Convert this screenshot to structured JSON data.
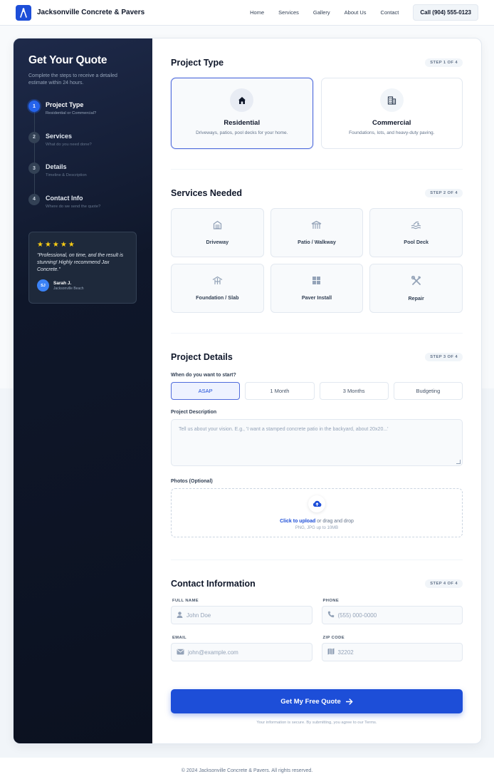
{
  "header": {
    "brand": "Jacksonville Concrete & Pavers",
    "nav": [
      "Home",
      "Services",
      "Gallery",
      "About Us",
      "Contact"
    ],
    "call": "Call (904) 555-0123"
  },
  "sidebar": {
    "title": "Get Your Quote",
    "subtitle": "Complete the steps to receive a detailed estimate within 24 hours.",
    "steps": [
      {
        "num": "1",
        "title": "Project Type",
        "desc": "Residential or Commercial?"
      },
      {
        "num": "2",
        "title": "Services",
        "desc": "What do you need done?"
      },
      {
        "num": "3",
        "title": "Details",
        "desc": "Timeline & Description"
      },
      {
        "num": "4",
        "title": "Contact Info",
        "desc": "Where do we send the quote?"
      }
    ],
    "review": {
      "rating": 5,
      "stars": "★★★★★",
      "quote": "\"Professional, on time, and the result is stunning! Highly recommend Jax Concrete.\"",
      "initials": "SJ",
      "name": "Sarah J.",
      "location": "Jacksonville Beach"
    }
  },
  "project_type": {
    "title": "Project Type",
    "badge": "STEP 1 OF 4",
    "options": [
      {
        "title": "Residential",
        "desc": "Driveways, patios, pool decks for your home.",
        "icon": "home-icon",
        "selected": true
      },
      {
        "title": "Commercial",
        "desc": "Foundations, lots, and heavy-duty paving.",
        "icon": "building-icon",
        "selected": false
      }
    ]
  },
  "services": {
    "title": "Services Needed",
    "badge": "STEP 2 OF 4",
    "items": [
      {
        "label": "Driveway",
        "icon": "garage-icon"
      },
      {
        "label": "Patio / Walkway",
        "icon": "deck-icon"
      },
      {
        "label": "Pool Deck",
        "icon": "pool-icon"
      },
      {
        "label": "Foundation / Slab",
        "icon": "foundation-icon"
      },
      {
        "label": "Paver Install",
        "icon": "grid-icon"
      },
      {
        "label": "Repair",
        "icon": "tools-icon"
      }
    ]
  },
  "details": {
    "title": "Project Details",
    "badge": "STEP 3 OF 4",
    "timeline_label": "When do you want to start?",
    "timeline": [
      "ASAP",
      "1 Month",
      "3 Months",
      "Budgeting"
    ],
    "timeline_selected": 0,
    "description_label": "Project Description",
    "description_placeholder": "Tell us about your vision. E.g., 'I want a stamped concrete patio in the backyard, about 20x20...'",
    "photos_label": "Photos (Optional)",
    "upload_link": "Click to upload",
    "upload_text": " or drag and drop",
    "upload_hint": "PNG, JPG up to 10MB"
  },
  "contact": {
    "title": "Contact Information",
    "badge": "STEP 4 OF 4",
    "fields": [
      {
        "label": "FULL NAME",
        "placeholder": "John Doe",
        "icon": "user-icon"
      },
      {
        "label": "PHONE",
        "placeholder": "(555) 000-0000",
        "icon": "phone-icon"
      },
      {
        "label": "EMAIL",
        "placeholder": "john@example.com",
        "icon": "mail-icon"
      },
      {
        "label": "ZIP CODE",
        "placeholder": "32202",
        "icon": "map-icon"
      }
    ]
  },
  "submit": {
    "label": "Get My Free Quote",
    "note": "Your information is secure. By submitting, you agree to our Terms."
  },
  "footer": {
    "text": "© 2024 Jacksonville Concrete & Pavers. All rights reserved."
  },
  "colors": {
    "primary": "#1d4ed8",
    "sidebar": "#0f172a",
    "star": "#facc15"
  }
}
